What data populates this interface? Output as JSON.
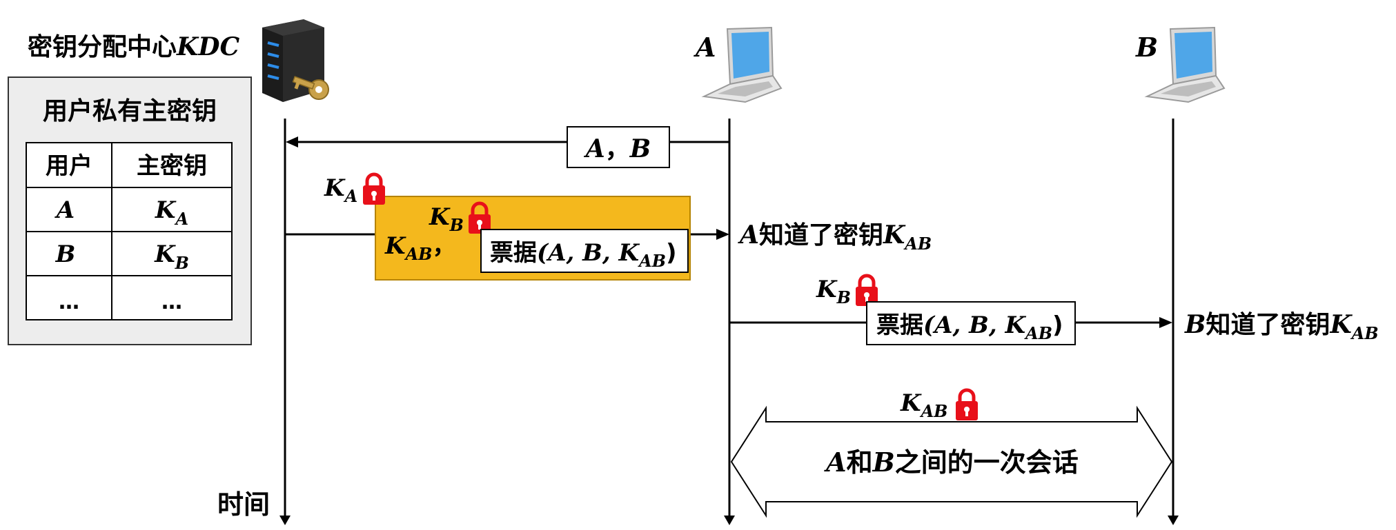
{
  "kdc": {
    "label": "密钥分配中心",
    "label_suffix": "KDC"
  },
  "hosts": {
    "a": "A",
    "b": "B"
  },
  "key_table": {
    "title": "用户私有主密钥",
    "headers": [
      "用户",
      "主密钥"
    ],
    "rows": [
      {
        "user": "A",
        "key": "K",
        "key_sub": "A"
      },
      {
        "user": "B",
        "key": "K",
        "key_sub": "B"
      },
      {
        "user": "…",
        "key": "…",
        "key_sub": ""
      }
    ]
  },
  "messages": {
    "request": {
      "a": "A",
      "sep": "，",
      "b": "B"
    },
    "reply": {
      "outer_key": "K",
      "outer_key_sub": "A",
      "inner_key": "K",
      "inner_key_sub": "B",
      "session_key": "K",
      "session_key_sub": "AB",
      "comma": "，",
      "ticket_label": "票据",
      "ticket_args": "(A, B, K",
      "ticket_sub": "AB",
      "ticket_close": ")"
    },
    "forward": {
      "key": "K",
      "key_sub": "B",
      "ticket_label": "票据",
      "ticket_args": "(A, B, K",
      "ticket_sub": "AB",
      "ticket_close": ")"
    }
  },
  "notes": {
    "a_knows": {
      "who": "A",
      "text": "知道了密钥",
      "key": "K",
      "key_sub": "AB"
    },
    "b_knows": {
      "who": "B",
      "text": "知道了密钥",
      "key": "K",
      "key_sub": "AB"
    }
  },
  "session": {
    "key": "K",
    "key_sub": "AB",
    "a": "A",
    "and": "和",
    "b": "B",
    "text": "之间的一次会话"
  },
  "time_label": "时间",
  "colors": {
    "highlight": "#F4B81D",
    "lock": "#E8101A",
    "screen": "#4FA6E8"
  }
}
